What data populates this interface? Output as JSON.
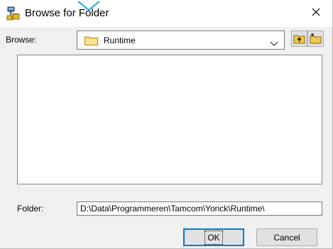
{
  "window": {
    "title": "Browse for Folder",
    "close_glyph": "×"
  },
  "browse": {
    "label": "Browse:",
    "combo_value": "Runtime",
    "combo_icon": "folder-icon",
    "up_button_icon": "up-one-level-icon",
    "new_folder_button_icon": "new-folder-icon"
  },
  "folder": {
    "label": "Folder:",
    "path": "D:\\Data\\Programmeren\\Tamcom\\Yorick\\Runtime\\"
  },
  "buttons": {
    "ok": "OK",
    "cancel": "Cancel"
  },
  "colors": {
    "accent": "#0078d7",
    "folder_yellow": "#f0c850"
  }
}
